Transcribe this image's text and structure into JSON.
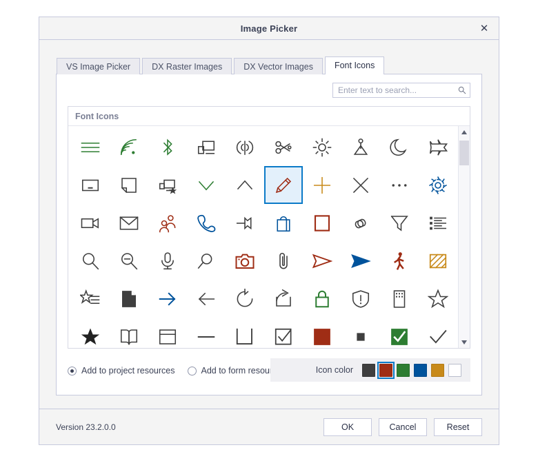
{
  "window": {
    "title": "Image Picker",
    "close_label": "✕"
  },
  "tabs": [
    {
      "label": "VS Image Picker",
      "active": false
    },
    {
      "label": "DX Raster Images",
      "active": false
    },
    {
      "label": "DX Vector Images",
      "active": false
    },
    {
      "label": "Font Icons",
      "active": true
    }
  ],
  "search": {
    "value": "",
    "placeholder": "Enter text to search...",
    "icon": "search-icon"
  },
  "gallery": {
    "group_title": "Font Icons",
    "columns": 10,
    "selected_index": 15,
    "scrollbar": {
      "up_arrow": "▲",
      "down_arrow": "▼"
    },
    "icons": [
      {
        "name": "menu-icon",
        "color": "#2d7d32"
      },
      {
        "name": "wifi-icon",
        "color": "#2d7d32"
      },
      {
        "name": "bluetooth-icon",
        "color": "#2d7d32"
      },
      {
        "name": "connect-to-display-icon",
        "color": "#3f3f3f"
      },
      {
        "name": "broadcast-icon",
        "color": "#3f3f3f"
      },
      {
        "name": "scissors-icon",
        "color": "#3f3f3f"
      },
      {
        "name": "brightness-icon",
        "color": "#3f3f3f"
      },
      {
        "name": "pin-tack-icon",
        "color": "#3f3f3f"
      },
      {
        "name": "moon-icon",
        "color": "#3f3f3f"
      },
      {
        "name": "airplane-icon",
        "color": "#3f3f3f"
      },
      {
        "name": "window-minimize-icon",
        "color": "#3f3f3f"
      },
      {
        "name": "page-corner-icon",
        "color": "#3f3f3f"
      },
      {
        "name": "favorite-display-icon",
        "color": "#3f3f3f"
      },
      {
        "name": "chevron-down-icon",
        "color": "#2d7d32"
      },
      {
        "name": "chevron-up-icon",
        "color": "#3f3f3f"
      },
      {
        "name": "edit-pencil-icon",
        "color": "#9f2d15"
      },
      {
        "name": "plus-icon",
        "color": "#c88a1a"
      },
      {
        "name": "close-x-icon",
        "color": "#3f3f3f"
      },
      {
        "name": "more-ellipsis-icon",
        "color": "#3f3f3f"
      },
      {
        "name": "settings-gear-icon",
        "color": "#00539c"
      },
      {
        "name": "video-camera-icon",
        "color": "#3f3f3f"
      },
      {
        "name": "envelope-mail-icon",
        "color": "#3f3f3f"
      },
      {
        "name": "people-group-icon",
        "color": "#9f2d15"
      },
      {
        "name": "phone-call-icon",
        "color": "#00539c"
      },
      {
        "name": "unpin-icon",
        "color": "#3f3f3f"
      },
      {
        "name": "shopping-bag-icon",
        "color": "#00539c"
      },
      {
        "name": "square-outline-icon",
        "color": "#9f2d15"
      },
      {
        "name": "link-chain-icon",
        "color": "#3f3f3f"
      },
      {
        "name": "filter-funnel-icon",
        "color": "#3f3f3f"
      },
      {
        "name": "bullet-list-icon",
        "color": "#3f3f3f"
      },
      {
        "name": "zoom-in-search-icon",
        "color": "#3f3f3f"
      },
      {
        "name": "zoom-out-icon",
        "color": "#3f3f3f"
      },
      {
        "name": "microphone-icon",
        "color": "#3f3f3f"
      },
      {
        "name": "search-small-icon",
        "color": "#3f3f3f"
      },
      {
        "name": "camera-icon",
        "color": "#9f2d15"
      },
      {
        "name": "paperclip-icon",
        "color": "#3f3f3f"
      },
      {
        "name": "send-outline-icon",
        "color": "#9f2d15"
      },
      {
        "name": "send-filled-icon",
        "color": "#00539c"
      },
      {
        "name": "walking-person-icon",
        "color": "#9f2d15"
      },
      {
        "name": "hatch-pattern-icon",
        "color": "#c88a1a"
      },
      {
        "name": "star-list-icon",
        "color": "#3f3f3f"
      },
      {
        "name": "document-filled-icon",
        "color": "#3f3f3f"
      },
      {
        "name": "arrow-right-icon",
        "color": "#00539c"
      },
      {
        "name": "arrow-left-icon",
        "color": "#3f3f3f"
      },
      {
        "name": "refresh-icon",
        "color": "#3f3f3f"
      },
      {
        "name": "share-icon",
        "color": "#3f3f3f"
      },
      {
        "name": "lock-icon",
        "color": "#2d7d32"
      },
      {
        "name": "shield-warning-icon",
        "color": "#3f3f3f"
      },
      {
        "name": "building-icon",
        "color": "#3f3f3f"
      },
      {
        "name": "star-outline-icon",
        "color": "#3f3f3f"
      },
      {
        "name": "star-filled-icon",
        "color": "#222222"
      },
      {
        "name": "book-open-icon",
        "color": "#3f3f3f"
      },
      {
        "name": "window-layout-icon",
        "color": "#3f3f3f"
      },
      {
        "name": "minus-line-icon",
        "color": "#3f3f3f"
      },
      {
        "name": "checkbox-empty-icon",
        "color": "#3f3f3f"
      },
      {
        "name": "checkbox-checked-icon",
        "color": "#3f3f3f"
      },
      {
        "name": "red-square-icon",
        "color": "#9f2d15"
      },
      {
        "name": "small-dark-square-icon",
        "color": "#3f3f3f"
      },
      {
        "name": "green-check-box-icon",
        "color": "#2d7d32"
      },
      {
        "name": "checkmark-icon",
        "color": "#3f3f3f"
      }
    ]
  },
  "options": {
    "radios": [
      {
        "label": "Add to project resources",
        "checked": true
      },
      {
        "label": "Add to form resources",
        "checked": false
      }
    ],
    "icon_color_label": "Icon color",
    "icon_colors": [
      {
        "name": "dark-gray",
        "hex": "#3f3f3f",
        "selected": false
      },
      {
        "name": "dark-red",
        "hex": "#9f2d15",
        "selected": true
      },
      {
        "name": "green",
        "hex": "#2d7d32",
        "selected": false
      },
      {
        "name": "blue",
        "hex": "#00539c",
        "selected": false
      },
      {
        "name": "orange",
        "hex": "#c88a1a",
        "selected": false
      },
      {
        "name": "white",
        "hex": "#ffffff",
        "selected": false
      }
    ]
  },
  "footer": {
    "version": "Version 23.2.0.0",
    "buttons": [
      {
        "label": "OK",
        "name": "ok-button"
      },
      {
        "label": "Cancel",
        "name": "cancel-button"
      },
      {
        "label": "Reset",
        "name": "reset-button"
      }
    ]
  }
}
